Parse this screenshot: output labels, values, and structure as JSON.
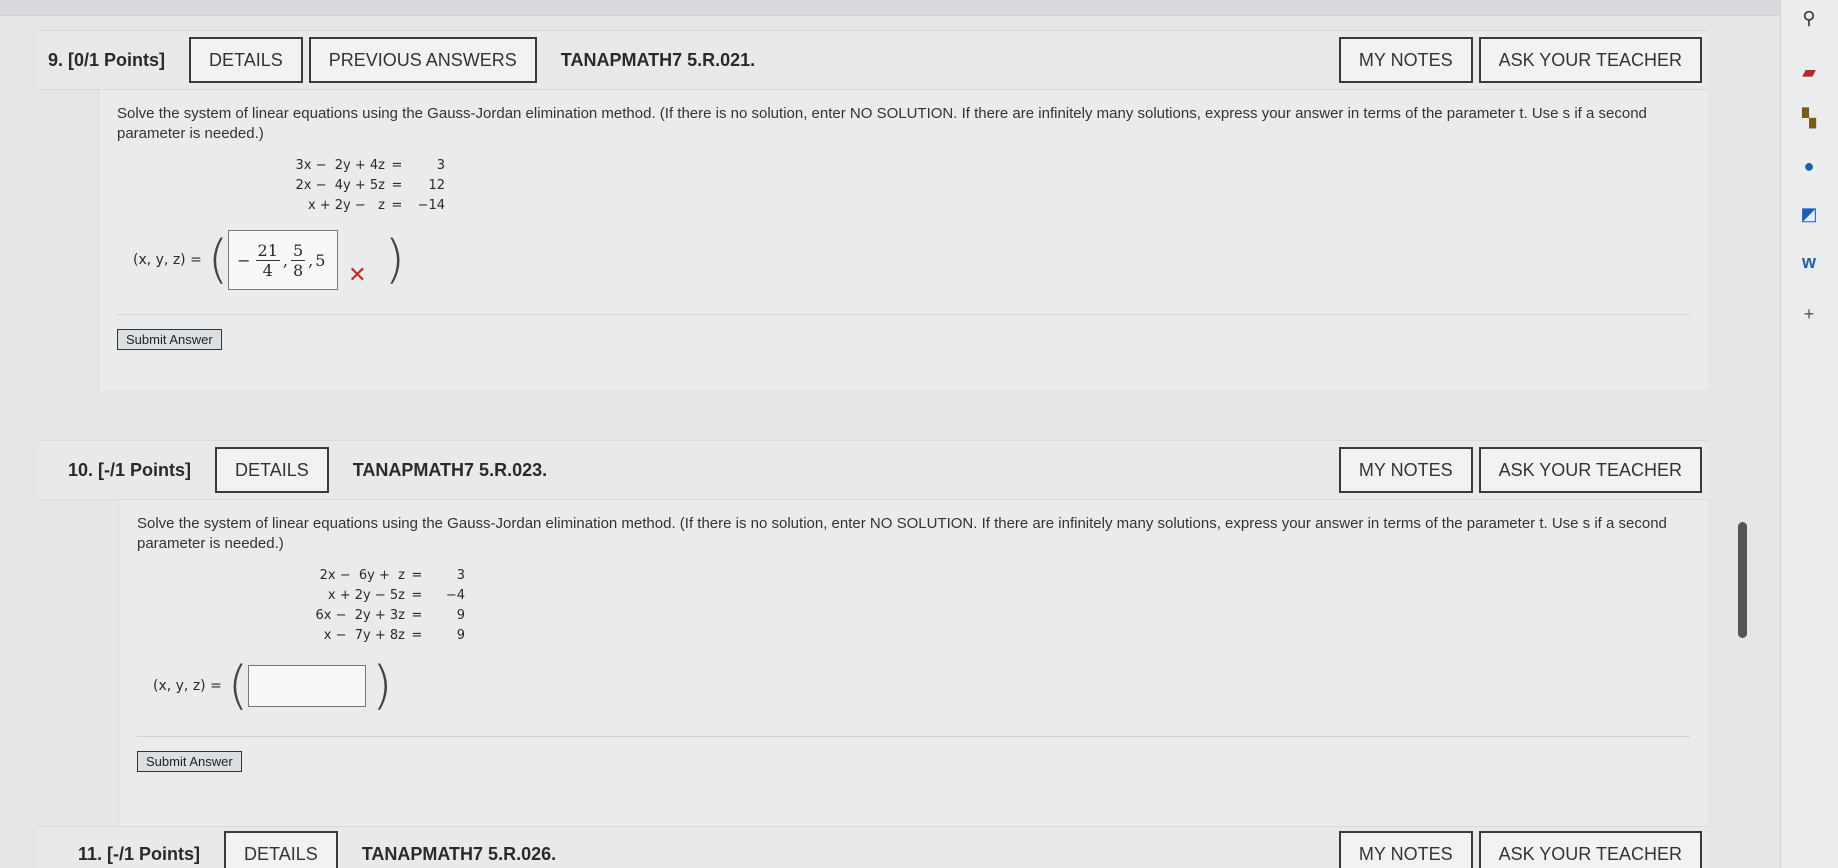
{
  "questions": [
    {
      "number": "9.",
      "points": "[0/1 Points]",
      "buttons": {
        "details": "DETAILS",
        "previous_answers": "PREVIOUS ANSWERS",
        "my_notes": "MY NOTES",
        "ask_teacher": "ASK YOUR TEACHER"
      },
      "code": "TANAPMATH7 5.R.021.",
      "prompt": "Solve the system of linear equations using the Gauss-Jordan elimination method. (If there is no solution, enter NO SOLUTION. If there are infinitely many solutions, express your answer in terms of the parameter t. Use s if a second parameter is needed.)",
      "equations": [
        {
          "lhs": "3x −  2y + 4z",
          "rhs": "3"
        },
        {
          "lhs": "2x −  4y + 5z",
          "rhs": "12"
        },
        {
          "lhs": "x + 2y −   z",
          "rhs": "−14"
        }
      ],
      "answer_label": "(x, y, z) =",
      "answer": {
        "sign": "−",
        "f1_num": "21",
        "f1_den": "4",
        "f2_num": "5",
        "f2_den": "8",
        "last": "5",
        "status": "incorrect"
      },
      "submit_label": "Submit Answer"
    },
    {
      "number": "10.",
      "points": "[-/1 Points]",
      "buttons": {
        "details": "DETAILS",
        "my_notes": "MY NOTES",
        "ask_teacher": "ASK YOUR TEACHER"
      },
      "code": "TANAPMATH7 5.R.023.",
      "prompt": "Solve the system of linear equations using the Gauss-Jordan elimination method. (If there is no solution, enter NO SOLUTION. If there are infinitely many solutions, express your answer in terms of the parameter t. Use s if a second parameter is needed.)",
      "equations": [
        {
          "lhs": "2x −  6y +  z",
          "rhs": "3"
        },
        {
          "lhs": "x + 2y − 5z",
          "rhs": "−4"
        },
        {
          "lhs": "6x −  2y + 3z",
          "rhs": "9"
        },
        {
          "lhs": "x −  7y + 8z",
          "rhs": "9"
        }
      ],
      "answer_label": "(x, y, z) =",
      "answer_value": "",
      "submit_label": "Submit Answer"
    },
    {
      "number": "11.",
      "points": "[-/1 Points]",
      "buttons": {
        "details": "DETAILS",
        "my_notes": "MY NOTES",
        "ask_teacher": "ASK YOUR TEACHER"
      },
      "code": "TANAPMATH7 5.R.026."
    }
  ],
  "colors": {
    "incorrect": "#c62828",
    "scrollbar": "#555555"
  },
  "sidebar_icons": [
    "search-icon",
    "briefcase-icon",
    "extension-icon",
    "circle-icon",
    "outlook-icon",
    "w-icon",
    "plus-icon"
  ]
}
